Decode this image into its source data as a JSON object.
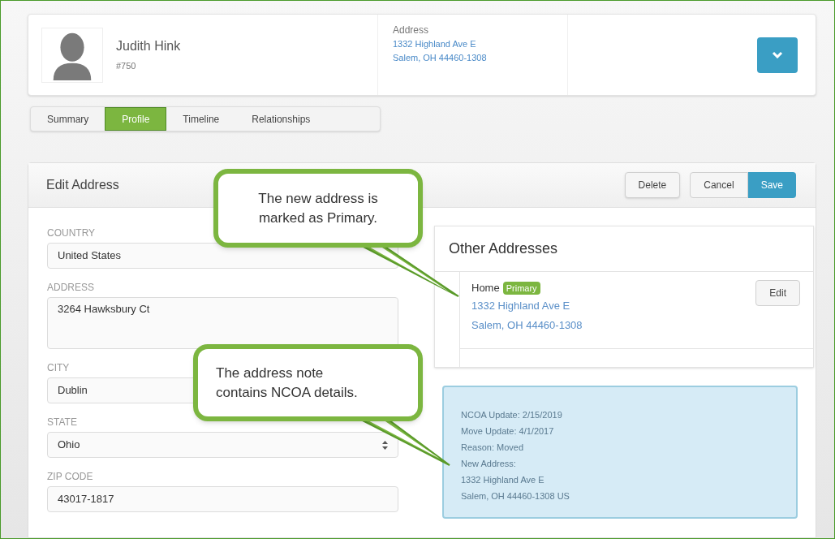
{
  "contact": {
    "name": "Judith Hink",
    "number": "#750",
    "address_label": "Address",
    "address_lines": [
      "1332 Highland Ave E",
      "Salem, OH 44460-1308"
    ]
  },
  "tabs": [
    {
      "label": "Summary",
      "selected": false
    },
    {
      "label": "Profile",
      "selected": true
    },
    {
      "label": "Timeline",
      "selected": false
    },
    {
      "label": "Relationships",
      "selected": false
    }
  ],
  "panel": {
    "title": "Edit Address",
    "buttons": [
      "Delete",
      "Cancel",
      "Save"
    ]
  },
  "fields": [
    {
      "label": "COUNTRY",
      "value": "United States",
      "kind": "text"
    },
    {
      "label": "ADDRESS",
      "value": "3264 Hawksbury Ct",
      "kind": "textarea"
    },
    {
      "label": "CITY",
      "value": "Dublin",
      "kind": "text"
    },
    {
      "label": "STATE",
      "value": "Ohio",
      "kind": "select"
    },
    {
      "label": "ZIP CODE",
      "value": "43017-1817",
      "kind": "text"
    }
  ],
  "other_addresses": {
    "title": "Other Addresses",
    "items": [
      {
        "type": "Home",
        "badge": "Primary",
        "lines": [
          "1332 Highland Ave E",
          "Salem, OH 44460-1308"
        ],
        "button": "Edit"
      }
    ]
  },
  "note": [
    "NCOA Update: 2/15/2019",
    "Move Update: 4/1/2017",
    "Reason: Moved",
    "New Address:",
    "1332 Highland Ave E",
    "Salem, OH 44460-1308 US"
  ],
  "callouts": [
    "The new address is marked as Primary.",
    "The address note contains NCOA details."
  ]
}
